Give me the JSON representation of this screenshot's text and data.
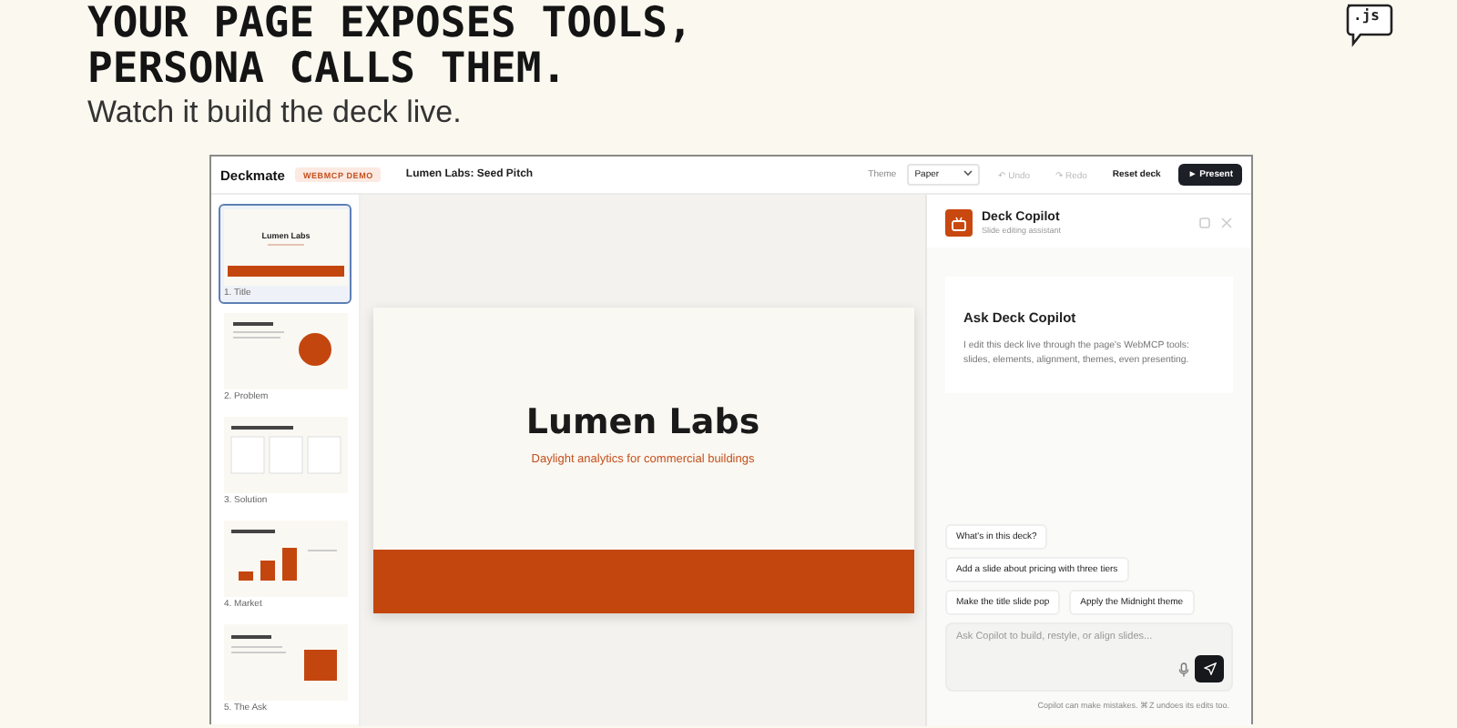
{
  "hero": {
    "headline_lines": [
      "YOUR PAGE EXPOSES TOOLS,",
      "PERSONA CALLS THEM."
    ],
    "subtitle": "Watch it build the deck live.",
    "logo_text": ".js"
  },
  "topbar": {
    "app_name": "Deckmate",
    "badge": "WEBMCP DEMO",
    "deck_title": "Lumen Labs: Seed Pitch",
    "theme_label": "Theme",
    "theme_value": "Paper",
    "actions": [
      {
        "kind": "ghost",
        "icon": "↶",
        "label": "Undo",
        "disabled": true
      },
      {
        "kind": "ghost",
        "icon": "↷",
        "label": "Redo",
        "disabled": true
      },
      {
        "kind": "outline",
        "label": "Reset deck",
        "disabled": false
      },
      {
        "kind": "primary",
        "icon": "►",
        "label": "Present",
        "disabled": false
      }
    ]
  },
  "slides": [
    {
      "kind": "title",
      "label": "1. Title",
      "heading": "Lumen Labs",
      "selected": true
    },
    {
      "kind": "problem",
      "label": "2. Problem",
      "selected": false
    },
    {
      "kind": "solution",
      "label": "3. Solution",
      "selected": false
    },
    {
      "kind": "market",
      "label": "4. Market",
      "selected": false
    },
    {
      "kind": "ask",
      "label": "5. The Ask",
      "selected": false
    }
  ],
  "canvas": {
    "title": "Lumen Labs",
    "subtitle": "Daylight analytics for commercial buildings"
  },
  "copilot": {
    "name": "Deck Copilot",
    "role": "Slide editing assistant",
    "intro_title": "Ask Deck Copilot",
    "intro_text": "I edit this deck live through the page's WebMCP tools: slides, elements, alignment, themes, even presenting.",
    "suggestions": [
      [
        "What's in this deck?"
      ],
      [
        "Add a slide about pricing with three tiers"
      ],
      [
        "Make the title slide pop",
        "Apply the Midnight theme"
      ]
    ],
    "input": {
      "placeholder": "Ask Copilot to build, restyle, or align slides..."
    },
    "footer": "Copilot can make mistakes. ⌘Z undoes its edits too."
  }
}
